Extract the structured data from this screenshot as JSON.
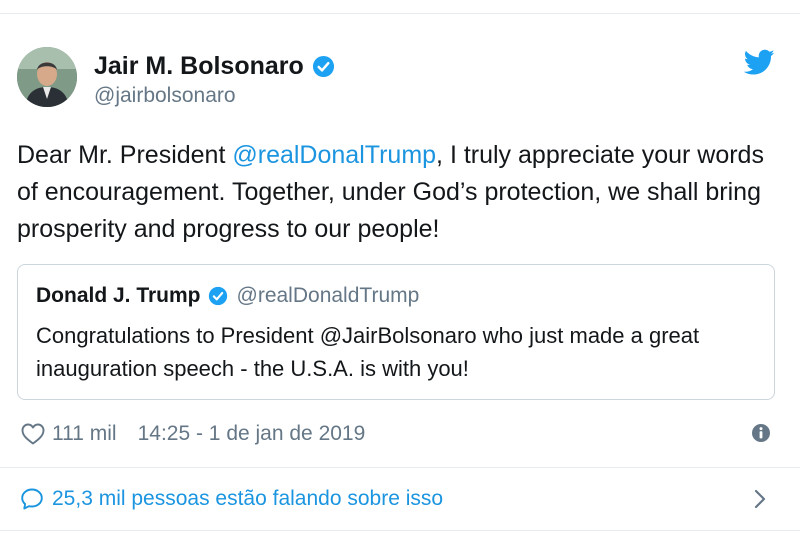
{
  "tweet": {
    "author": {
      "display_name": "Jair M. Bolsonaro",
      "handle": "@jairbolsonaro",
      "verified": true
    },
    "text_parts": {
      "before": "Dear Mr. President ",
      "mention": "@realDonalTrump",
      "after": ", I truly appreciate your words of encouragement. Together, under God’s protection, we shall bring prosperity and progress to our people!"
    },
    "quoted": {
      "display_name": "Donald J. Trump",
      "handle": "@realDonaldTrump",
      "verified": true,
      "text": "Congratulations to President @JairBolsonaro who just made a great inauguration speech - the U.S.A. is with you!"
    },
    "likes": "111 mil",
    "timestamp": "14:25 - 1 de jan de 2019",
    "conversation_label": "25,3 mil pessoas estão falando sobre isso"
  },
  "icons": {
    "brand": "twitter-bird-icon",
    "verified": "verified-badge-icon",
    "like": "heart-icon",
    "info": "info-icon",
    "conversation": "speech-bubble-icon",
    "chevron": "chevron-right-icon"
  },
  "colors": {
    "accent": "#1b95e0",
    "text": "#14171a",
    "secondary": "#657786",
    "border": "#ccd6dd"
  }
}
